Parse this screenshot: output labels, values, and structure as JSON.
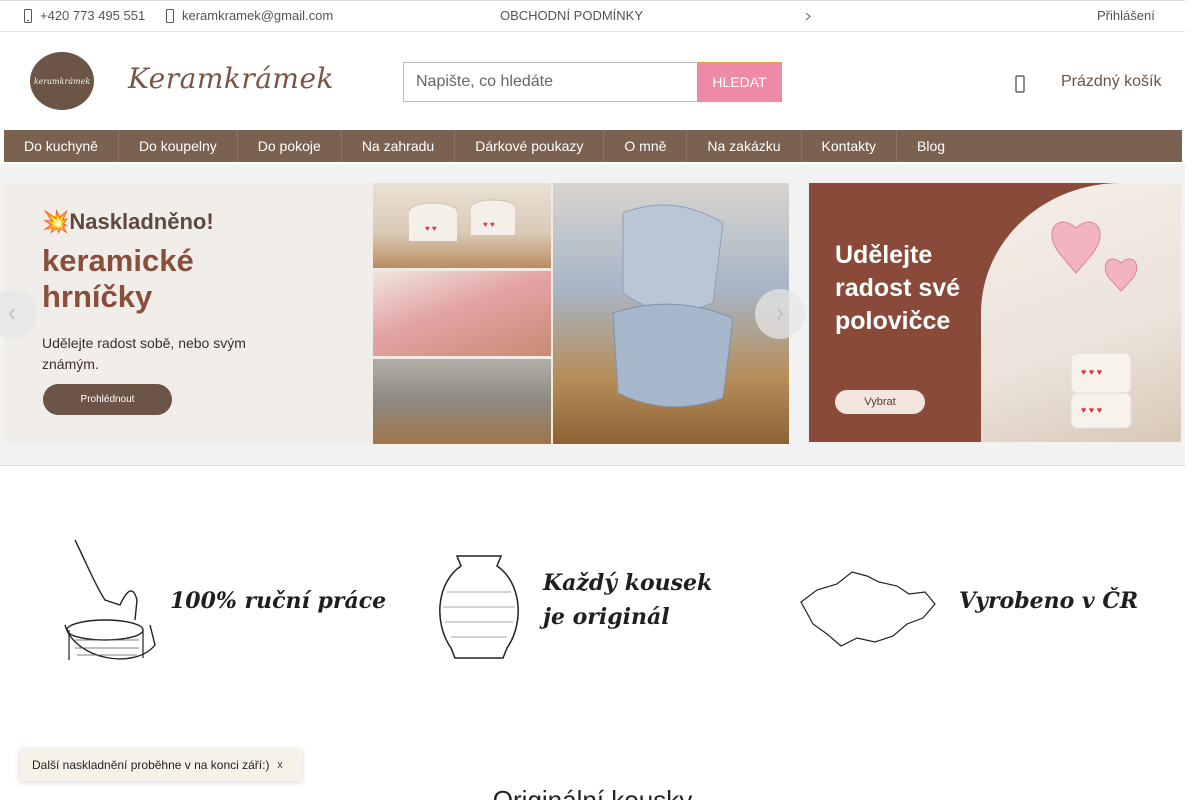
{
  "topbar": {
    "phone": "+420 773 495 551",
    "phone_icon": "phone-icon",
    "email": "keramkramek@gmail.com",
    "email_icon": "mail-icon",
    "terms": "OBCHODNÍ PODMÍNKY",
    "more_icon": "chevron-down-icon",
    "login": "Přihlášení"
  },
  "header": {
    "logo_badge": "keramkrámek",
    "logo_text": "Keramkrámek",
    "search_placeholder": "Napište, co hledáte",
    "search_button": "HLEDAT",
    "cart_icon": "cart-icon",
    "cart_label": "Prázdný košík"
  },
  "nav": {
    "items": [
      {
        "label": "Do kuchyně"
      },
      {
        "label": "Do koupelny"
      },
      {
        "label": "Do pokoje"
      },
      {
        "label": "Na zahradu"
      },
      {
        "label": "Dárkové poukazy"
      },
      {
        "label": "O mně"
      },
      {
        "label": "Na zakázku"
      },
      {
        "label": "Kontakty"
      },
      {
        "label": "Blog"
      }
    ]
  },
  "hero": {
    "banner1": {
      "kicker": "💥Naskladněno!",
      "title": "keramické hrníčky",
      "subtitle": "Udělejte radost sobě, nebo svým známým.",
      "button": "Prohlédnout"
    },
    "banner2": {
      "title": "Udělejte radost své polovičce",
      "button": "Vybrat"
    },
    "prev_icon": "chevron-left-icon",
    "next_icon": "chevron-right-icon"
  },
  "features": [
    {
      "text": "100% ruční práce",
      "icon": "hands-pottery-icon"
    },
    {
      "text": "Každý kousek je originál",
      "icon": "vase-icon"
    },
    {
      "text": "Vyrobeno v ČR",
      "icon": "czech-map-icon"
    }
  ],
  "toast": {
    "text": "Další naskladnění proběhne v na konci září:)",
    "close_icon": "close-icon"
  },
  "section": {
    "title": "Originální kousky"
  },
  "colors": {
    "nav_bg": "#7a6150",
    "brand_brown": "#6b5546",
    "search_button": "#ee8aa8",
    "banner2_bg": "#8a4a3a"
  }
}
